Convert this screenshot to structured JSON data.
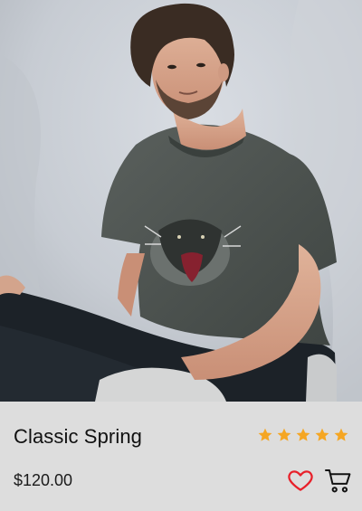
{
  "product": {
    "name": "Classic Spring",
    "price": "$120.00",
    "rating": 5,
    "rating_max": 5,
    "image_alt": "Man in charcoal graphic tee seated on floor"
  },
  "colors": {
    "star": "#f5a623",
    "heart": "#e8202a",
    "cart": "#111111",
    "panel": "#dddddd"
  },
  "icons": {
    "star": "star-icon",
    "favorite": "heart-icon",
    "cart": "cart-icon"
  }
}
